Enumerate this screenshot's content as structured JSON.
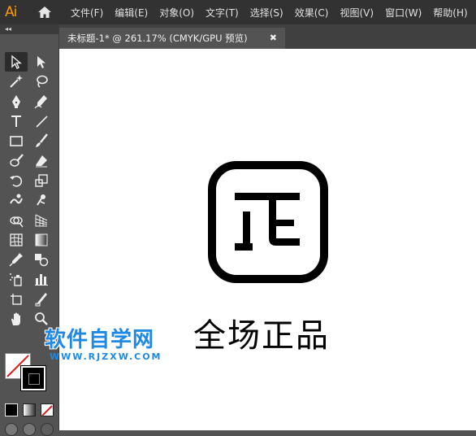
{
  "app": {
    "logo": "Ai",
    "home_icon": "home-icon"
  },
  "menu": [
    "文件(F)",
    "编辑(E)",
    "对象(O)",
    "文字(T)",
    "选择(S)",
    "效果(C)",
    "视图(V)",
    "窗口(W)",
    "帮助(H)"
  ],
  "toolbar": {
    "header": "◂◂",
    "tools": [
      "selection-tool-icon",
      "direct-selection-tool-icon",
      "magic-wand-icon",
      "lasso-icon",
      "pen-icon",
      "curvature-icon",
      "type-icon",
      "line-icon",
      "rectangle-icon",
      "paintbrush-icon",
      "blob-brush-icon",
      "eraser-icon",
      "rotate-icon",
      "scale-icon",
      "warp-icon",
      "puppet-warp-icon",
      "shape-builder-icon",
      "perspective-grid-icon",
      "mesh-icon",
      "gradient-icon",
      "eyedropper-icon",
      "blend-icon",
      "symbol-sprayer-icon",
      "column-graph-icon",
      "artboard-icon",
      "slice-icon",
      "hand-icon",
      "zoom-icon"
    ]
  },
  "document_tab": {
    "title": "未标题-1* @ 261.17% (CMYK/GPU 预览)",
    "close": "✖"
  },
  "artwork": {
    "text": "全场正品"
  },
  "watermark": {
    "title": "软件自学网",
    "url": "WWW.RJZXW.COM"
  }
}
